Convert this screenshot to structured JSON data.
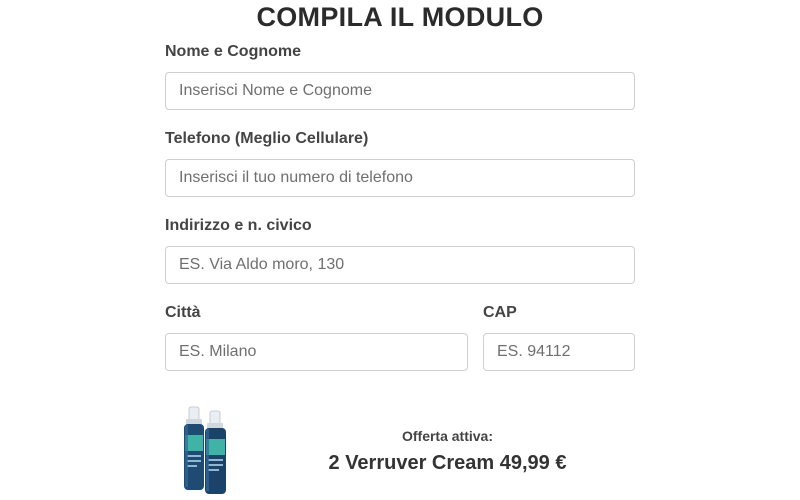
{
  "form": {
    "title": "COMPILA IL MODULO",
    "fields": {
      "name": {
        "label": "Nome e Cognome",
        "placeholder": "Inserisci Nome e Cognome",
        "value": ""
      },
      "phone": {
        "label": "Telefono (Meglio Cellulare)",
        "placeholder": "Inserisci il tuo numero di telefono",
        "value": ""
      },
      "address": {
        "label": "Indirizzo e n. civico",
        "placeholder": "ES. Via Aldo moro, 130",
        "value": ""
      },
      "city": {
        "label": "Città",
        "placeholder": "ES. Milano",
        "value": ""
      },
      "zip": {
        "label": "CAP",
        "placeholder": "ES. 94112",
        "value": ""
      }
    }
  },
  "offer": {
    "label": "Offerta attiva:",
    "price_text": "2 Verruver Cream 49,99 €",
    "product_image": "two-spray-bottles-product-image"
  },
  "colors": {
    "title": "#2b2b2b",
    "label": "#444444",
    "input_border": "#cfcfcf",
    "placeholder": "#6f6f6f",
    "bottle_body": "#1f4a72",
    "bottle_label": "#3fb3a6"
  }
}
